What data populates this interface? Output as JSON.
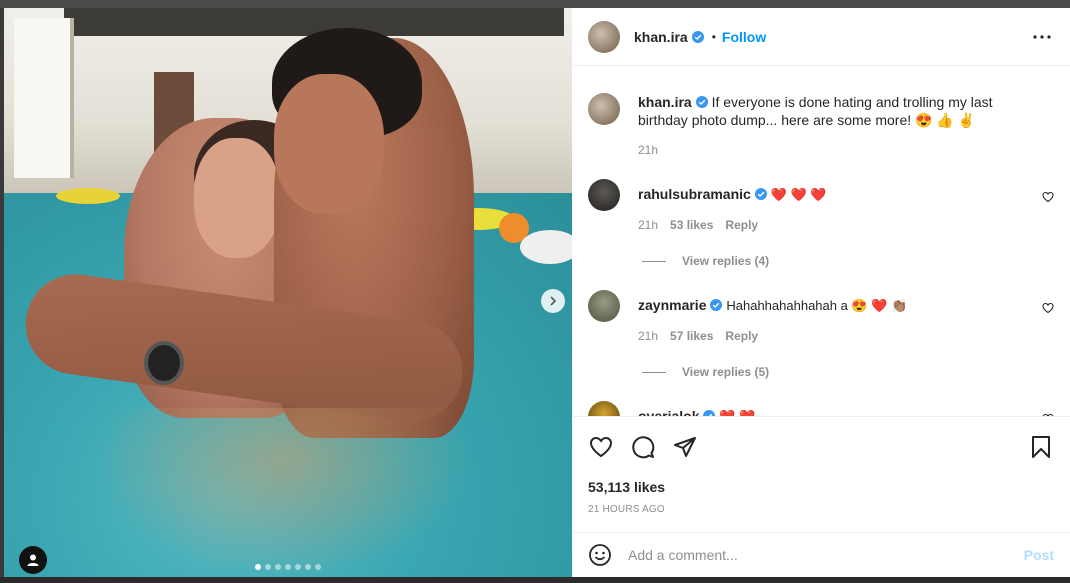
{
  "post": {
    "author": "khan.ira",
    "follow_label": "Follow",
    "bullet": "•",
    "media": {
      "slide_count": 7,
      "active_slide": 1
    },
    "icons": {
      "more": "more-horizontal-icon",
      "next": "chevron-right-icon",
      "user_tag": "user-tag-icon",
      "verified": "verified-badge-icon"
    }
  },
  "caption": {
    "username": "khan.ira",
    "text": "If everyone is done hating and trolling my last birthday photo dump... here are some more! 😍 👍 ✌",
    "time": "21h"
  },
  "comments": [
    {
      "username": "rahulsubramanic",
      "text": "❤️ ❤️ ❤️",
      "time": "21h",
      "likes": "53 likes",
      "reply_label": "Reply",
      "view_replies": "View replies (4)"
    },
    {
      "username": "zaynmarie",
      "text": "Hahahhahahhahah a 😍 ❤️ 👏🏽",
      "time": "21h",
      "likes": "57 likes",
      "reply_label": "Reply",
      "view_replies": "View replies (5)"
    },
    {
      "username": "overialok",
      "text": "❤️ ❤️"
    }
  ],
  "actions": {
    "like_icon": "heart-icon",
    "comment_icon": "comment-icon",
    "share_icon": "share-icon",
    "save_icon": "bookmark-icon",
    "likes": "53,113 likes",
    "time_ago": "21 HOURS AGO"
  },
  "comment_box": {
    "emoji_icon": "emoji-icon",
    "placeholder": "Add a comment...",
    "post_label": "Post"
  },
  "colors": {
    "link": "#0095f6",
    "verified": "#3897f0",
    "heart": "#ed4956",
    "post_disabled": "#b2dffc"
  }
}
